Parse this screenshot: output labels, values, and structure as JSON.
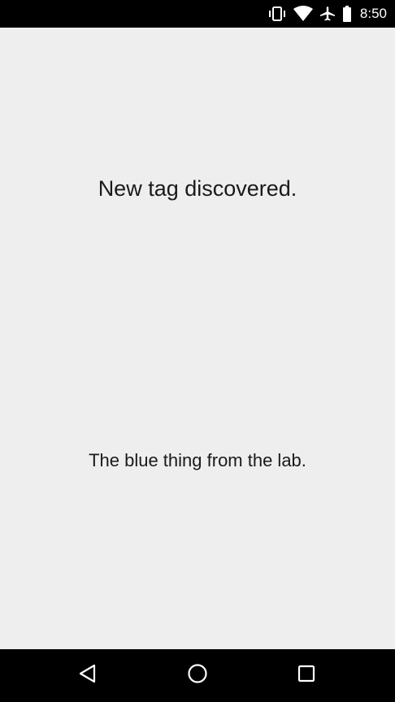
{
  "status_bar": {
    "time": "8:50",
    "icons": [
      "vibrate-icon",
      "wifi-icon",
      "airplane-mode-icon",
      "battery-icon"
    ]
  },
  "main": {
    "headline": "New tag discovered.",
    "tag_content": "The blue thing from the lab."
  },
  "nav_bar": {
    "buttons": [
      "back-icon",
      "home-icon",
      "recents-icon"
    ]
  },
  "colors": {
    "background": "#eeeeee",
    "bars": "#000000",
    "text": "#1a1a1a"
  }
}
